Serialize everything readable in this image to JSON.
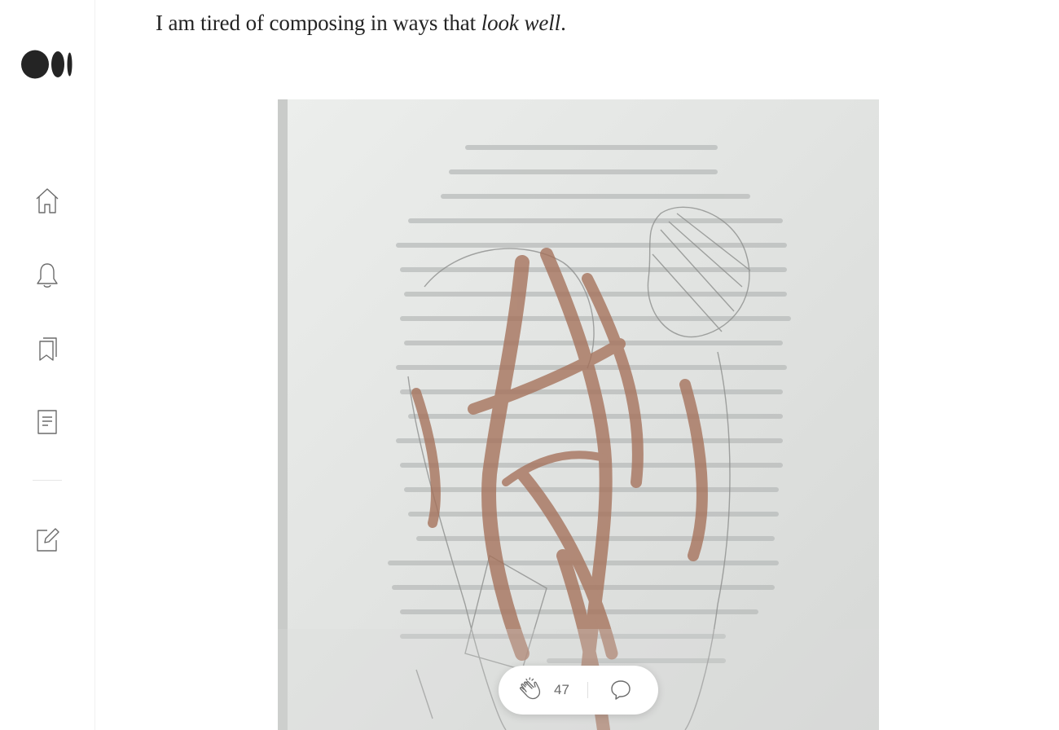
{
  "sidebar": {
    "logo_icon": "medium-logo",
    "items": [
      {
        "name": "home",
        "icon": "home-icon"
      },
      {
        "name": "notifications",
        "icon": "bell-icon"
      },
      {
        "name": "lists",
        "icon": "bookmarks-icon"
      },
      {
        "name": "stories",
        "icon": "document-icon"
      },
      {
        "name": "write",
        "icon": "write-icon"
      }
    ]
  },
  "article": {
    "paragraph": {
      "before": "I am tired of composing in ways that ",
      "emphasis": "look well",
      "after": "."
    },
    "figure": {
      "content": "pencil-drawing-of-embracing-figures-over-mirrored-handwritten-text"
    }
  },
  "floating_bar": {
    "clap_icon": "clap-icon",
    "clap_count": "47",
    "response_icon": "speech-bubble-icon"
  },
  "colors": {
    "text": "#242424",
    "icon": "#6b6b6b",
    "logo": "#242424"
  }
}
